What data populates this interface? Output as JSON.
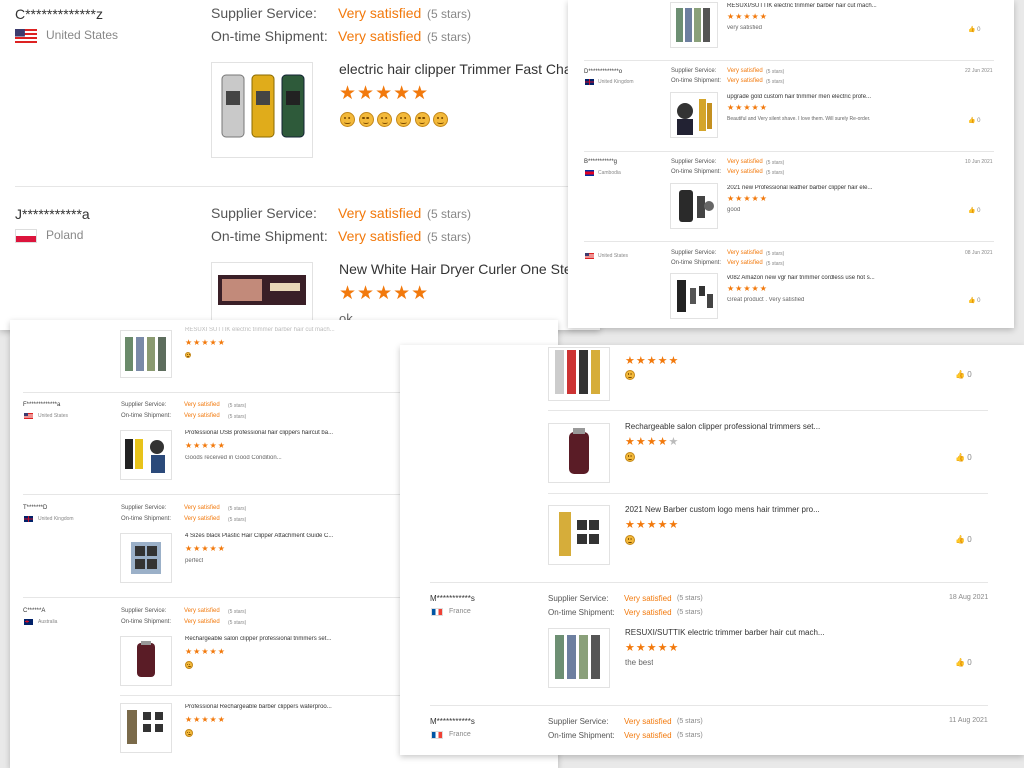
{
  "labels": {
    "supplier": "Supplier Service:",
    "shipment": "On-time Shipment:",
    "satisfied": "Very satisfied",
    "five": "(5 stars)"
  },
  "panel1": {
    "r1": {
      "user": "C*************z",
      "country": "United States",
      "title": "electric hair clipper Trimmer Fast Char",
      "stars": "★★★★★",
      "emojis": 6
    },
    "r2": {
      "user": "J***********a",
      "country": "Poland",
      "title": "New White Hair Dryer Curler One Step",
      "stars": "★★★★★",
      "text": "ok"
    }
  },
  "panel2": {
    "r0": {
      "title": "RESUXI/SUTTIK electric trimmer barber hair cut mach...",
      "stars": "★★★★★",
      "text": "very satisfied",
      "likes": "0"
    },
    "r1": {
      "user": "D*************o",
      "country": "United Kingdom",
      "date": "22 Jun 2021",
      "title": "upgrade gold custom hair trimmer men electric profe...",
      "stars": "★★★★★",
      "text": "Beautiful and Very silent shave. I love them. Will surely Re-order.",
      "likes": "0"
    },
    "r2": {
      "user": "B***********g",
      "country": "Cambodia",
      "date": "10 Jun 2021",
      "title": "2021 new Professional leather barber clipper hair ele...",
      "stars": "★★★★★",
      "text": "good",
      "likes": "0"
    },
    "r3": {
      "user": "",
      "country": "United States",
      "date": "08 Jun 2021",
      "title": "v082 Amazon new vgr hair trimmer cordless use hot s...",
      "stars": "★★★★★",
      "text": "Great product . Very satisfied",
      "likes": "0"
    }
  },
  "panel3": {
    "r0": {
      "title": "RESUXI SUTTIK electric trimmer barber hair cut mach...",
      "stars": "★★★★★"
    },
    "r1": {
      "user": "F*************a",
      "country": "United States",
      "title": "Professional USB professional hair clippers haircut ba...",
      "stars": "★★★★★",
      "text": "Goods received in Good Condition..."
    },
    "r2": {
      "user": "T*******D",
      "country": "United Kingdom",
      "title": "4 Sizes black Plastic Hair Clipper Attachment Guide C...",
      "stars": "★★★★★",
      "text": "perfect"
    },
    "r3": {
      "user": "C******A",
      "country": "Australia",
      "title": "Rechargeable salon clipper professional trimmers set...",
      "stars": "★★★★★"
    },
    "r4": {
      "title": "Professional Rechargeable barber clippers waterproo...",
      "stars": "★★★★★"
    }
  },
  "panel4": {
    "r0": {
      "stars": "★★★★★",
      "likes": "0"
    },
    "r1": {
      "title": "Rechargeable salon clipper professional trimmers set...",
      "stars_on": "★★★★",
      "stars_off": "★",
      "likes": "0"
    },
    "r2": {
      "title": "2021 New Barber custom logo mens hair trimmer pro...",
      "stars": "★★★★★",
      "likes": "0"
    },
    "r3": {
      "user": "M***********s",
      "country": "France",
      "date": "18 Aug 2021",
      "title": "RESUXI/SUTTIK electric trimmer barber hair cut mach...",
      "stars": "★★★★★",
      "text": "the best",
      "likes": "0"
    },
    "r4": {
      "user": "M***********s",
      "country": "France",
      "date": "11 Aug 2021"
    }
  },
  "icons": {
    "like": "thumbs-up-icon",
    "emoji": "smiley-emoji"
  },
  "colors": {
    "accent": "#f2790c",
    "text": "#333333",
    "muted": "#888888"
  }
}
